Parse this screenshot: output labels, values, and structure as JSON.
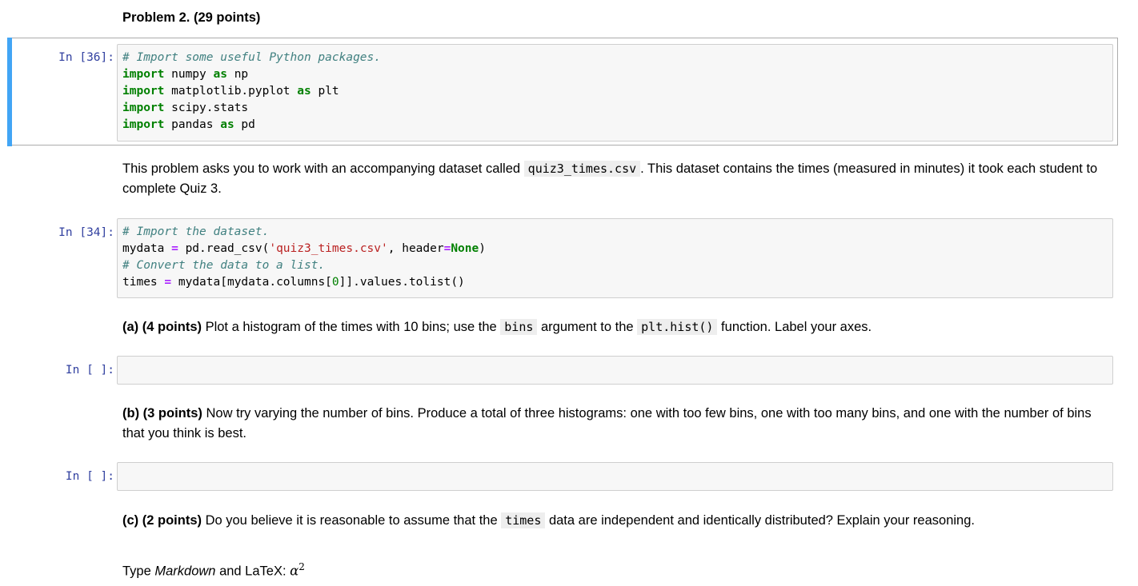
{
  "heading": "Problem 2. (29 points)",
  "cells": {
    "import_cell": {
      "prompt": "In [36]:",
      "lines": [
        [
          {
            "t": "# Import some useful Python packages.",
            "c": "cm"
          }
        ],
        [
          {
            "t": "import",
            "c": "kw"
          },
          {
            "t": " numpy ",
            "c": ""
          },
          {
            "t": "as",
            "c": "kw"
          },
          {
            "t": " np",
            "c": ""
          }
        ],
        [
          {
            "t": "import",
            "c": "kw"
          },
          {
            "t": " matplotlib.pyplot ",
            "c": ""
          },
          {
            "t": "as",
            "c": "kw"
          },
          {
            "t": " plt",
            "c": ""
          }
        ],
        [
          {
            "t": "import",
            "c": "kw"
          },
          {
            "t": " scipy.stats",
            "c": ""
          }
        ],
        [
          {
            "t": "import",
            "c": "kw"
          },
          {
            "t": " pandas ",
            "c": ""
          },
          {
            "t": "as",
            "c": "kw"
          },
          {
            "t": " pd",
            "c": ""
          }
        ]
      ]
    },
    "dataset_cell": {
      "prompt": "In [34]:",
      "lines": [
        [
          {
            "t": "# Import the dataset.",
            "c": "cm"
          }
        ],
        [
          {
            "t": "mydata ",
            "c": ""
          },
          {
            "t": "=",
            "c": "op"
          },
          {
            "t": " pd.read_csv(",
            "c": ""
          },
          {
            "t": "'quiz3_times.csv'",
            "c": "st"
          },
          {
            "t": ", header",
            "c": ""
          },
          {
            "t": "=",
            "c": "op"
          },
          {
            "t": "None",
            "c": "kw"
          },
          {
            "t": ")",
            "c": ""
          }
        ],
        [
          {
            "t": "# Convert the data to a list.",
            "c": "cm"
          }
        ],
        [
          {
            "t": "times ",
            "c": ""
          },
          {
            "t": "=",
            "c": "op"
          },
          {
            "t": " mydata[mydata.columns[",
            "c": ""
          },
          {
            "t": "0",
            "c": "nu"
          },
          {
            "t": "]].values.tolist()",
            "c": ""
          }
        ]
      ]
    },
    "empty_cell_a": {
      "prompt": "In [ ]:"
    },
    "empty_cell_b": {
      "prompt": "In [ ]:"
    }
  },
  "intro": {
    "before": "This problem asks you to work with an accompanying dataset called ",
    "code": "quiz3_times.csv",
    "after": ". This dataset contains the times (measured in minutes) it took each student to complete Quiz 3."
  },
  "part_a": {
    "label": "(a) (4 points)",
    "text1": " Plot a histogram of the times with 10 bins; use the ",
    "code1": "bins",
    "text2": " argument to the ",
    "code2": "plt.hist()",
    "text3": " function. Label your axes."
  },
  "part_b": {
    "label": "(b) (3 points)",
    "text": " Now try varying the number of bins. Produce a total of three histograms: one with too few bins, one with too many bins, and one with the number of bins that you think is best."
  },
  "part_c": {
    "label": "(c) (2 points)",
    "text1": " Do you believe it is reasonable to assume that the ",
    "code1": "times",
    "text2": " data are independent and identically distributed? Explain your reasoning."
  },
  "answer": {
    "prefix": "Type ",
    "markdown": "Markdown",
    "middle": " and LaTeX: ",
    "math": "α",
    "sup": "2"
  }
}
